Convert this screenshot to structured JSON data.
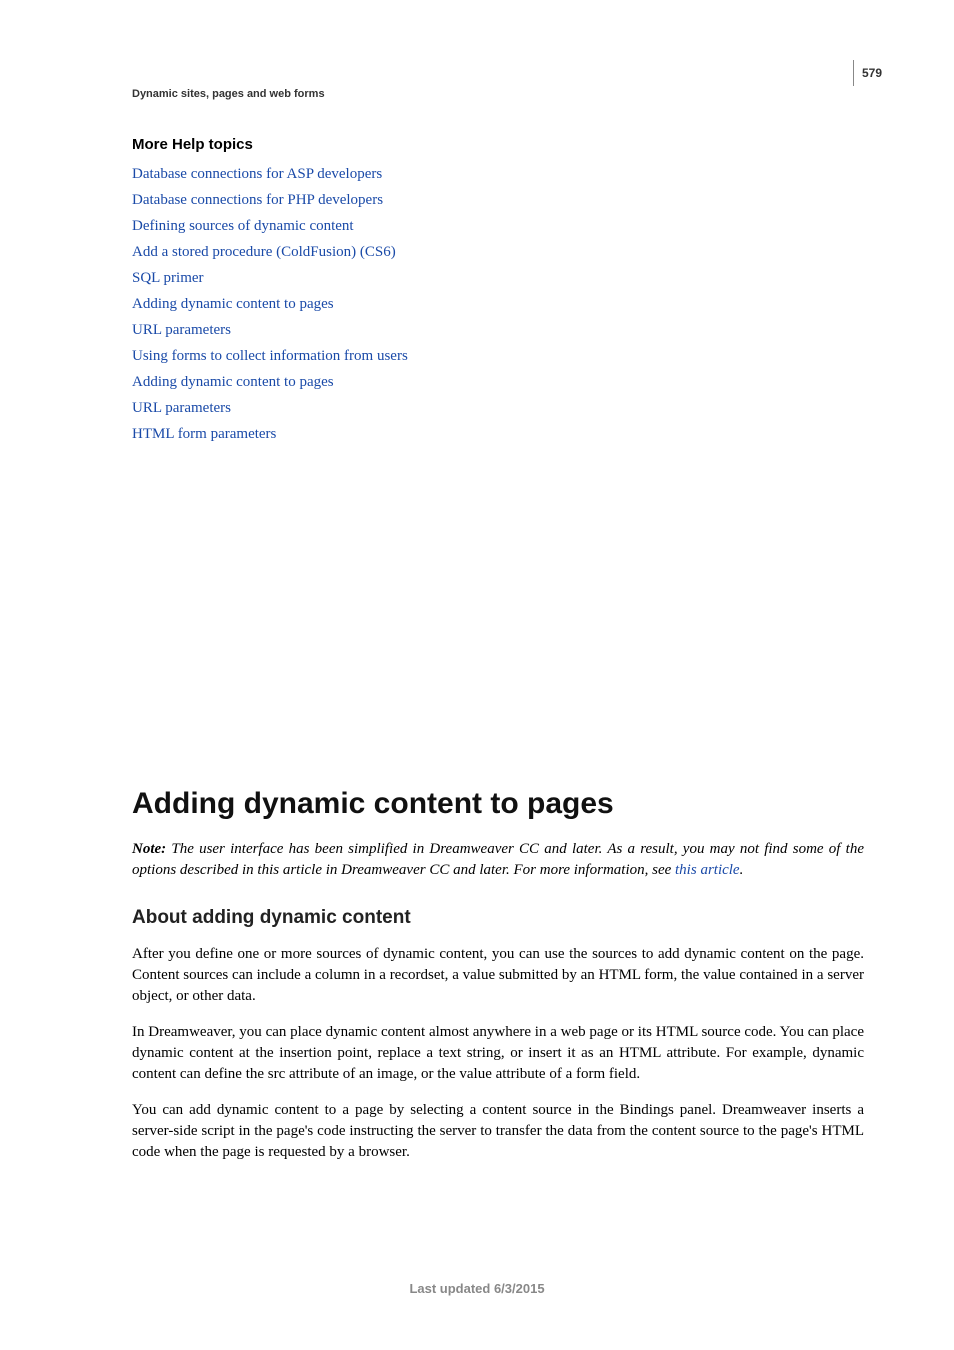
{
  "page_number": "579",
  "running_head": "Dynamic sites, pages and web forms",
  "more_help": {
    "heading": "More Help topics",
    "links": [
      "Database connections for ASP developers",
      "Database connections for PHP developers",
      "Defining sources of dynamic content",
      "Add a stored procedure (ColdFusion) (CS6)",
      "SQL primer",
      "Adding dynamic content to pages",
      "URL parameters",
      "Using forms to collect information from users",
      "Adding dynamic content to pages",
      "URL parameters",
      "HTML form parameters"
    ]
  },
  "main_heading": "Adding dynamic content to pages",
  "note": {
    "label": "Note:",
    "body_a": " The user interface has been simplified in Dreamweaver CC and later. As a result, you may not find some of the options described in this article in Dreamweaver CC and later. For more information, see ",
    "link": "this article",
    "body_b": "."
  },
  "sub_heading": "About adding dynamic content",
  "paragraphs": [
    "After you define one or more sources of dynamic content, you can use the sources to add dynamic content on the page. Content sources can include a column in a recordset, a value submitted by an HTML form, the value contained in a server object, or other data.",
    "In Dreamweaver, you can place dynamic content almost anywhere in a web page or its HTML source code. You can place dynamic content at the insertion point, replace a text string, or insert it as an HTML attribute. For example, dynamic content can define the src attribute of an image, or the value attribute of a form field.",
    "You can add dynamic content to a page by selecting a content source in the Bindings panel. Dreamweaver inserts a server-side script in the page's code instructing the server to transfer the data from the content source to the page's HTML code when the page is requested by a browser."
  ],
  "footer": "Last updated 6/3/2015"
}
